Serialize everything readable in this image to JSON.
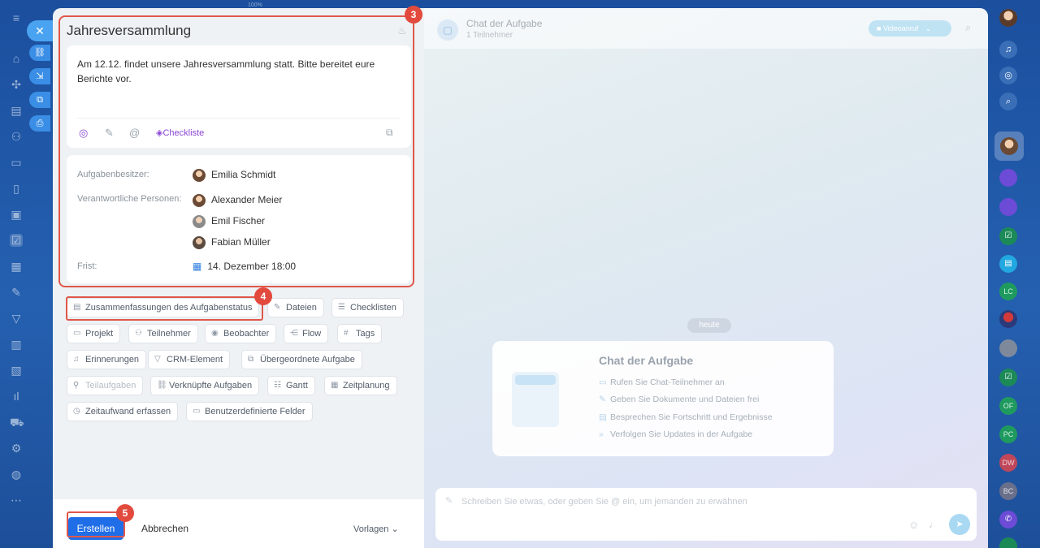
{
  "topbar": {
    "zoom": "100%"
  },
  "task": {
    "title": "Jahresversammlung",
    "description": "Am 12.12. findet unsere Jahresversammlung statt. Bitte bereitet eure Berichte vor.",
    "checklist_label": "Checkliste",
    "owner_label": "Aufgabenbesitzer:",
    "owner": "Emilia Schmidt",
    "responsible_label": "Verantwortliche Personen:",
    "responsible": [
      "Alexander Meier",
      "Emil Fischer",
      "Fabian Müller"
    ],
    "deadline_label": "Frist:",
    "deadline": "14. Dezember 18:00"
  },
  "chips": {
    "summaries": "Zusammenfassungen des Aufgabenstatus",
    "files": "Dateien",
    "checklists": "Checklisten",
    "project": "Projekt",
    "participants": "Teilnehmer",
    "observers": "Beobachter",
    "flow": "Flow",
    "tags": "Tags",
    "reminders": "Erinnerungen",
    "crm": "CRM-Element",
    "parent_task": "Übergeordnete Aufgabe",
    "subtasks": "Teilaufgaben",
    "linked_tasks": "Verknüpfte Aufgaben",
    "gantt": "Gantt",
    "scheduling": "Zeitplanung",
    "time_tracking": "Zeitaufwand erfassen",
    "custom_fields": "Benutzerdefinierte Felder"
  },
  "footer": {
    "create": "Erstellen",
    "cancel": "Abbrechen",
    "templates": "Vorlagen"
  },
  "chat": {
    "title": "Chat der Aufgabe",
    "participants": "1 Teilnehmer",
    "video_call": "Videoanruf",
    "date_separator": "heute",
    "info_title": "Chat der Aufgabe",
    "info_items": [
      "Rufen Sie Chat-Teilnehmer an",
      "Geben Sie Dokumente und Dateien frei",
      "Besprechen Sie Fortschritt und Ergebnisse",
      "Verfolgen Sie Updates in der Aufgabe"
    ],
    "composer_placeholder": "Schreiben Sie etwas, oder geben Sie @ ein, um jemanden zu erwähnen"
  },
  "right_rail": {
    "initials": [
      "LC",
      "OF",
      "PC",
      "DW",
      "BC"
    ]
  },
  "annotations": {
    "badge3": "3",
    "badge4": "4",
    "badge5": "5"
  },
  "colors": {
    "accent": "#1f6ee8",
    "highlight": "#e0574a",
    "checklist": "#8b46d6"
  }
}
